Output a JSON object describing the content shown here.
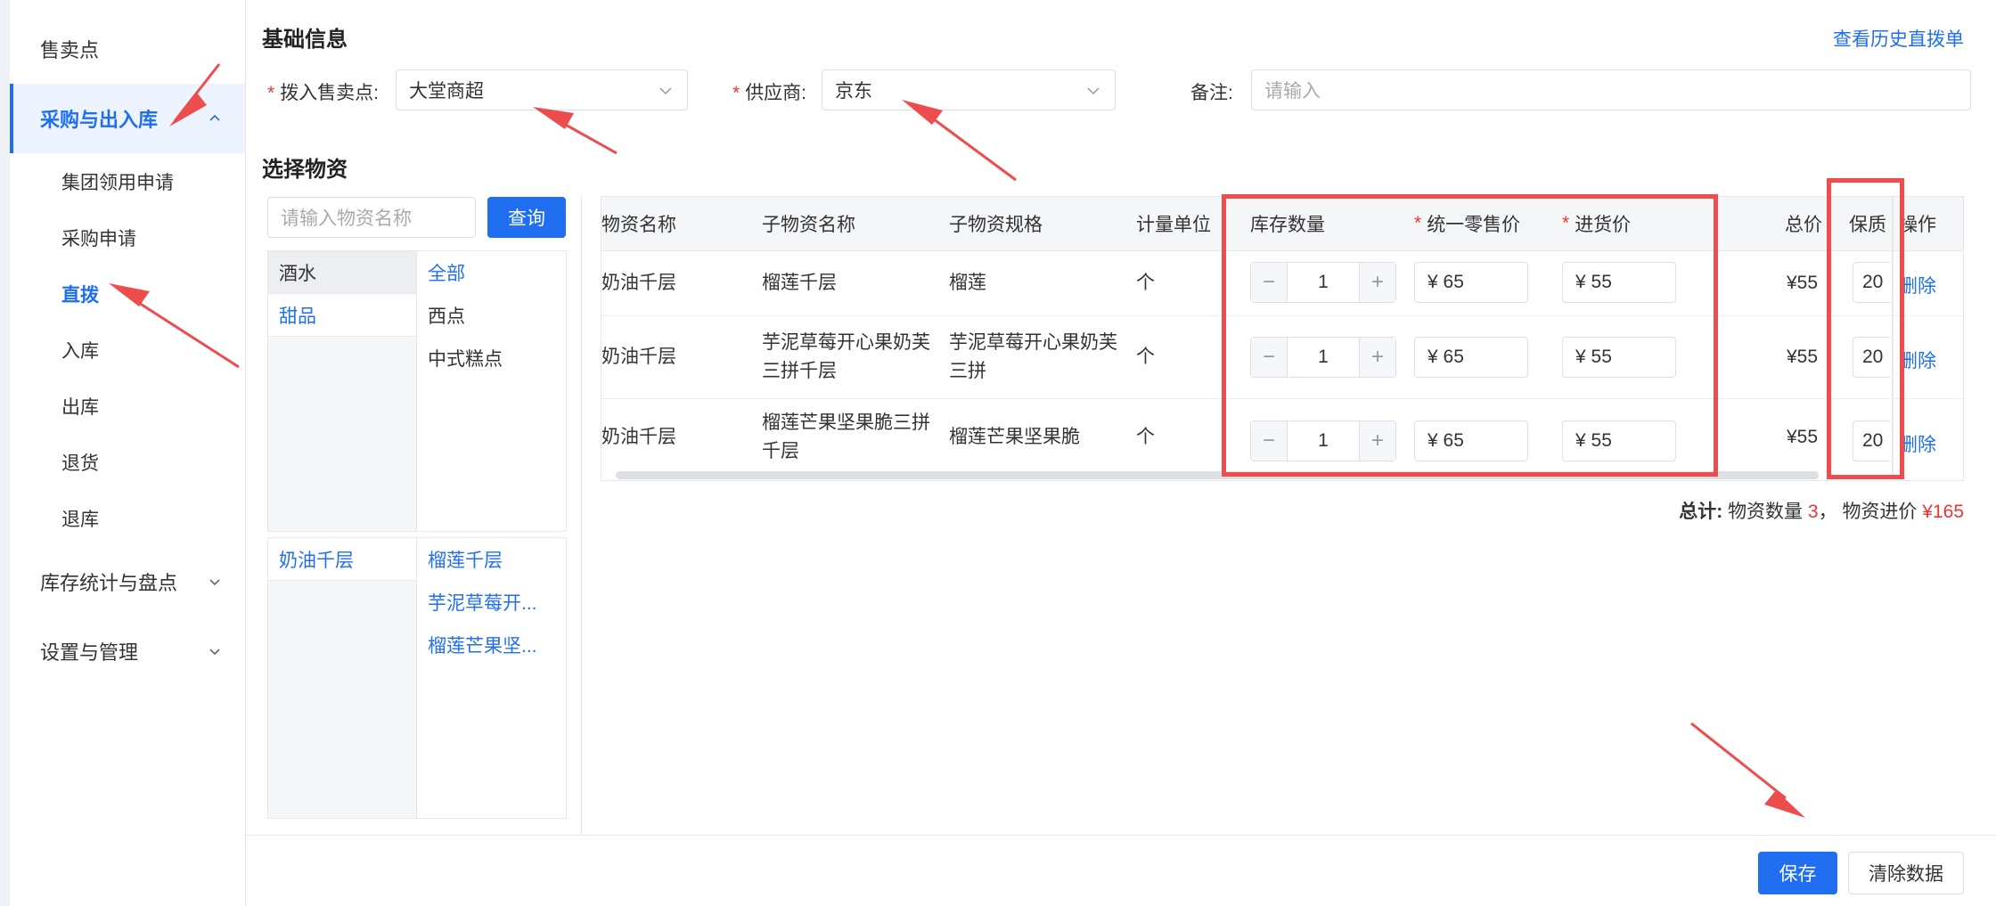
{
  "sidebar": {
    "items": [
      {
        "label": "售卖点"
      },
      {
        "label": "采购与出入库"
      },
      {
        "label": "集团领用申请"
      },
      {
        "label": "采购申请"
      },
      {
        "label": "直拨"
      },
      {
        "label": "入库"
      },
      {
        "label": "出库"
      },
      {
        "label": "退货"
      },
      {
        "label": "退库"
      },
      {
        "label": "库存统计与盘点"
      },
      {
        "label": "设置与管理"
      }
    ]
  },
  "basic": {
    "title": "基础信息",
    "history_link": "查看历史直拨单",
    "outlet_label": "拨入售卖点:",
    "outlet_value": "大堂商超",
    "supplier_label": "供应商:",
    "supplier_value": "京东",
    "remark_label": "备注:",
    "remark_placeholder": "请输入",
    "required_mark": "*"
  },
  "materials": {
    "title": "选择物资",
    "search_placeholder": "请输入物资名称",
    "query_button": "查询",
    "level1": [
      "酒水",
      "甜品"
    ],
    "level2": [
      "全部",
      "西点",
      "中式糕点"
    ],
    "level3_left": [
      "奶油千层"
    ],
    "level3_right": [
      "榴莲千层",
      "芋泥草莓开...",
      "榴莲芒果坚..."
    ]
  },
  "table": {
    "headers": {
      "name": "物资名称",
      "sub_name": "子物资名称",
      "sub_spec": "子物资规格",
      "unit": "计量单位",
      "stock": "库存数量",
      "retail": "统一零售价",
      "purchase": "进货价",
      "total": "总价",
      "shelf": "保质",
      "action": "操作"
    },
    "rows": [
      {
        "name": "奶油千层",
        "sub_name": "榴莲千层",
        "sub_spec": "榴莲",
        "unit": "个",
        "qty": "1",
        "retail": "¥  65",
        "purchase": "¥  55",
        "total": "¥55",
        "shelf": "20",
        "action": "删除"
      },
      {
        "name": "奶油千层",
        "sub_name": "芋泥草莓开心果奶芙三拼千层",
        "sub_spec": "芋泥草莓开心果奶芙三拼",
        "unit": "个",
        "qty": "1",
        "retail": "¥  65",
        "purchase": "¥  55",
        "total": "¥55",
        "shelf": "20",
        "action": "删除"
      },
      {
        "name": "奶油千层",
        "sub_name": "榴莲芒果坚果脆三拼千层",
        "sub_spec": "榴莲芒果坚果脆",
        "unit": "个",
        "qty": "1",
        "retail": "¥  65",
        "purchase": "¥  55",
        "total": "¥55",
        "shelf": "20",
        "action": "删除"
      }
    ]
  },
  "summary": {
    "label": "总计:",
    "qty_label": "物资数量",
    "qty_value": "3",
    "sep": "，",
    "cost_label": "物资进价",
    "cost_value": "¥165"
  },
  "footer": {
    "save": "保存",
    "clear": "清除数据"
  },
  "colors": {
    "accent": "#1f6ff0",
    "annotation": "#ee4d4d",
    "required": "#e33333"
  }
}
